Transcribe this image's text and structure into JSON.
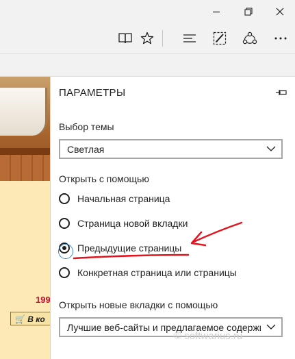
{
  "settings": {
    "title": "ПАРАМЕТРЫ",
    "theme": {
      "label": "Выбор темы",
      "value": "Светлая"
    },
    "open_with": {
      "label": "Открыть с помощью",
      "options": [
        {
          "label": "Начальная страница",
          "selected": false
        },
        {
          "label": "Страница новой вкладки",
          "selected": false
        },
        {
          "label": "Предыдущие страницы",
          "selected": true
        },
        {
          "label": "Конкретная страница или страницы",
          "selected": false
        }
      ]
    },
    "new_tabs": {
      "label": "Открыть новые вкладки с помощью",
      "value": "Лучшие веб-сайты и предлагаемое содержимое"
    }
  },
  "webpage": {
    "price": "199",
    "cart_button": "В ко"
  },
  "watermark": "© softwarius.ru",
  "colors": {
    "annotation_red": "#e0151f",
    "panel_bg": "#ffffff",
    "chrome_bg": "#f2f2f2",
    "page_bg": "#fde9b6"
  },
  "icons": {
    "window": [
      "minimize-icon",
      "restore-icon",
      "close-icon"
    ],
    "toolbar": [
      "reading-view-icon",
      "favorite-star-icon",
      "hub-icon",
      "web-note-icon",
      "share-icon",
      "more-icon"
    ],
    "panel": [
      "pin-icon",
      "chevron-down-icon"
    ]
  }
}
